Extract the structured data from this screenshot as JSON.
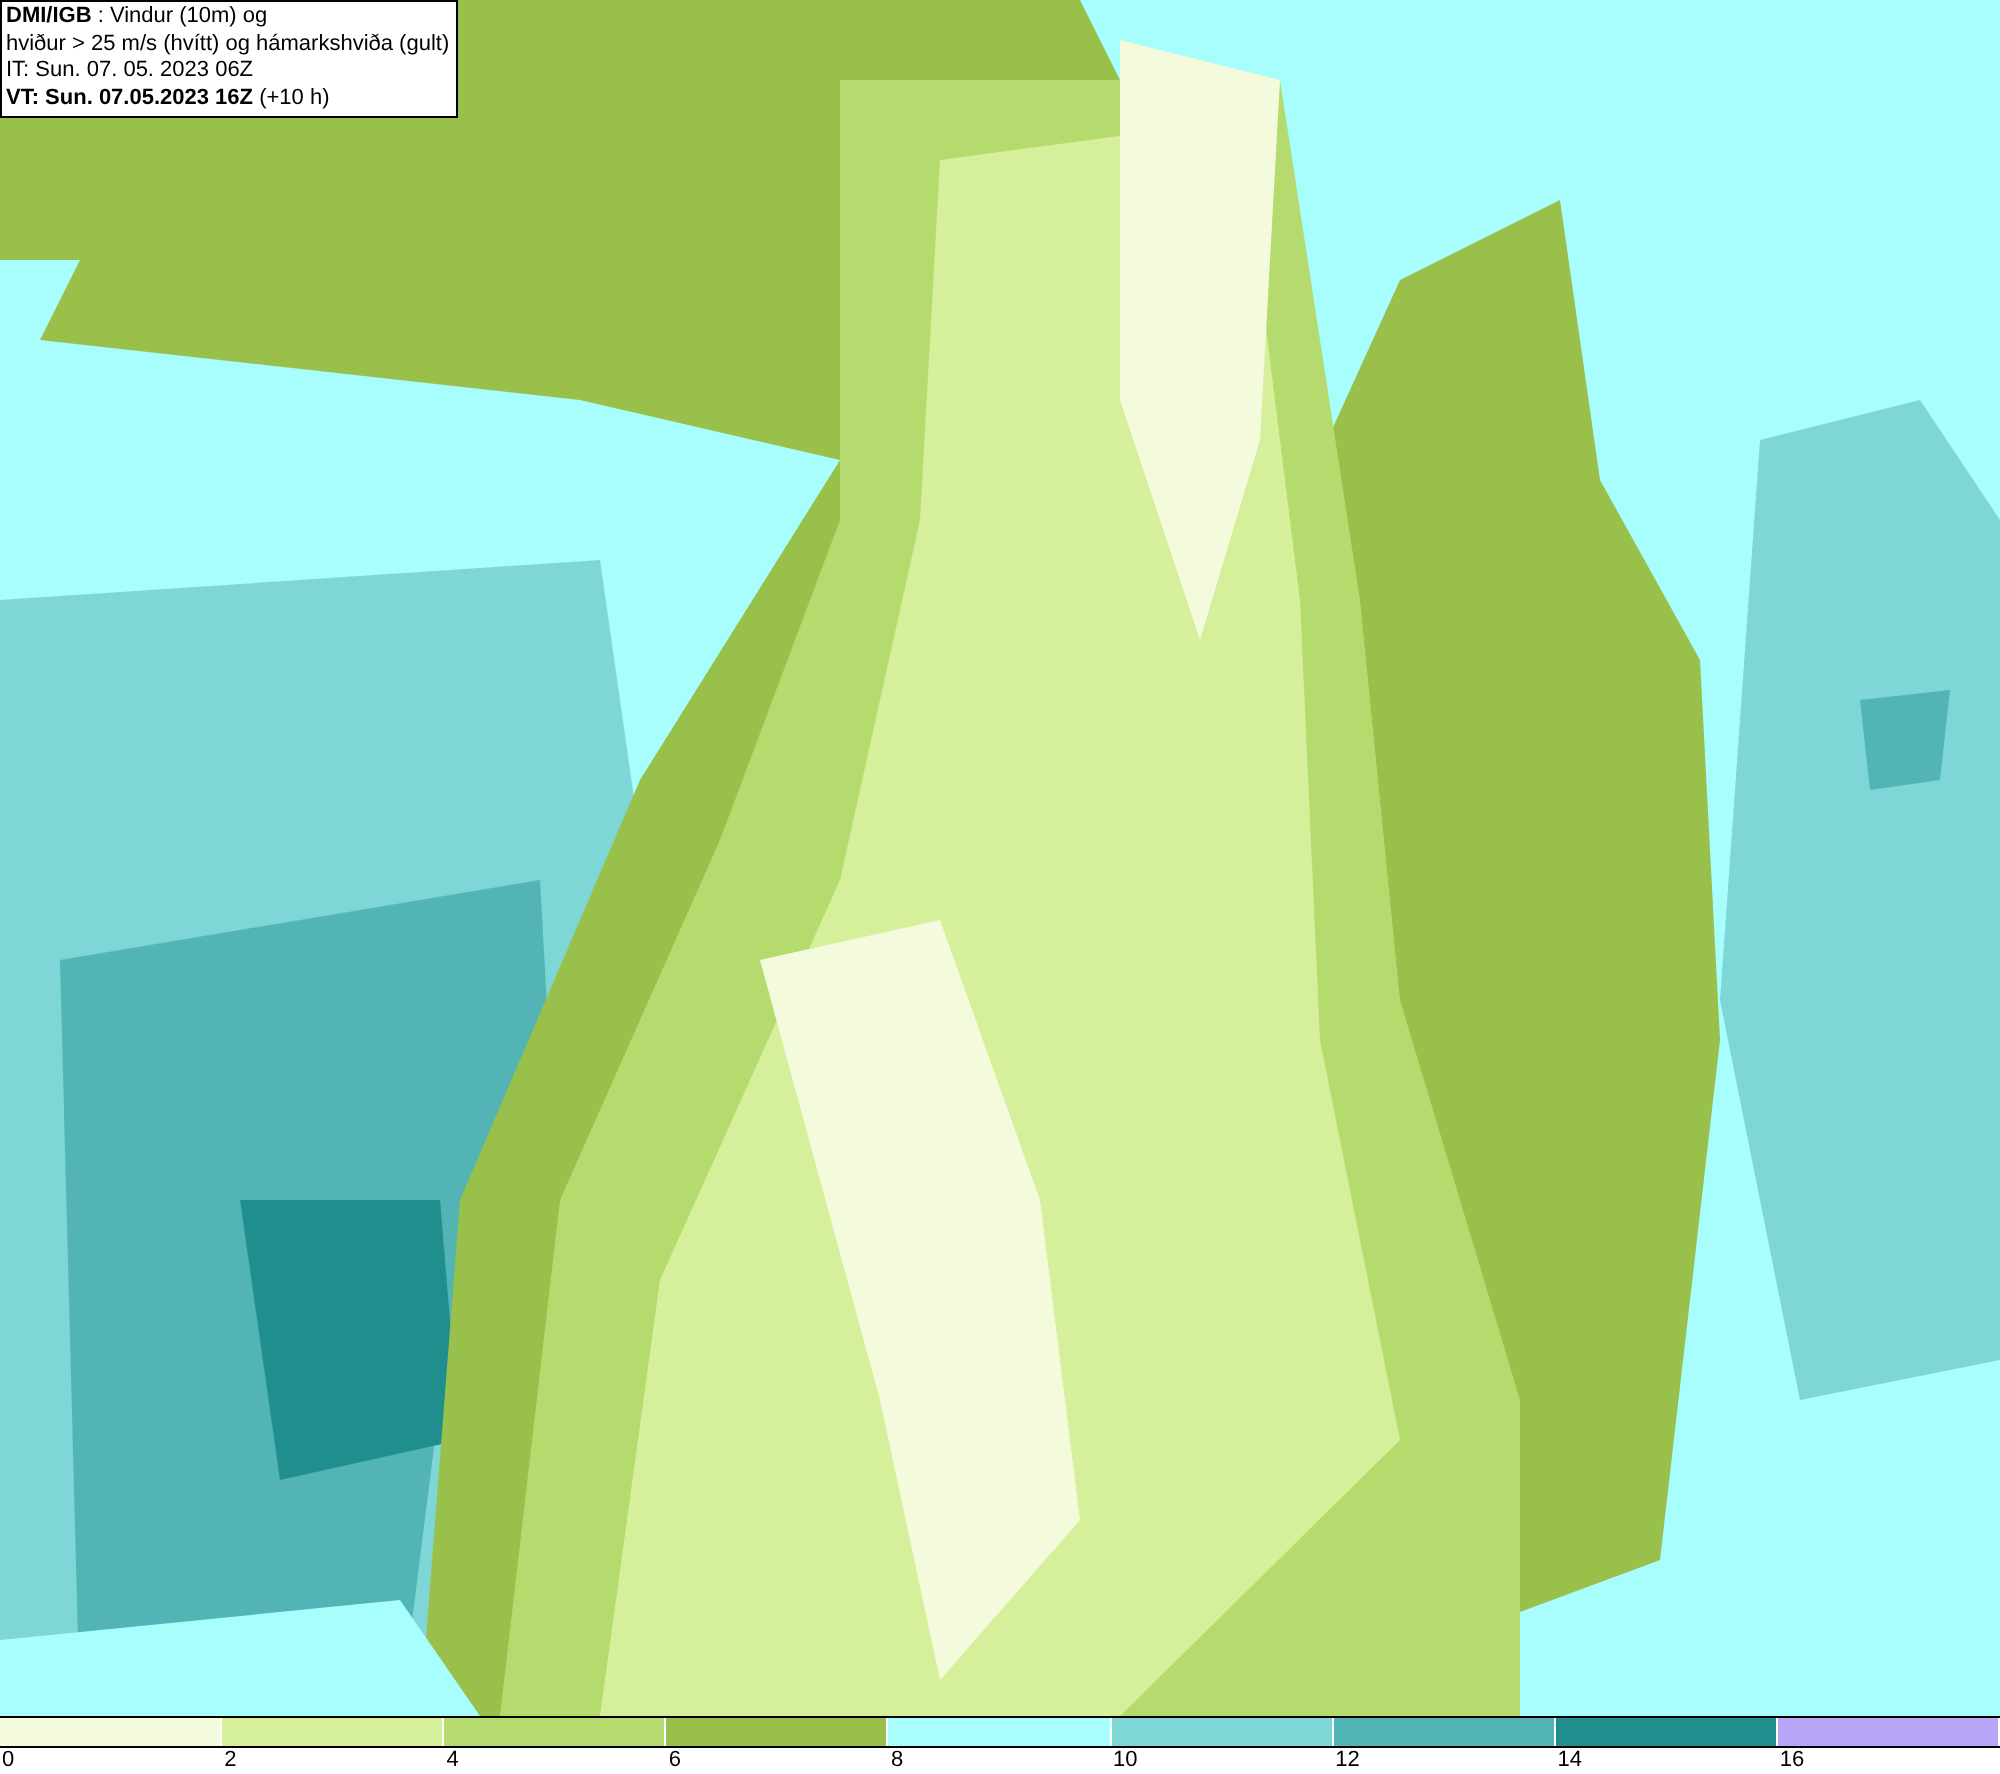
{
  "info_box": {
    "lines": [
      "**DMI/IGB** : Vindur (10m) og",
      "hviður > 25 m/s (hvítt) og hámarkshviða (gult)",
      "IT: Sun. 07. 05. 2023 06Z",
      "**VT: Sun. 07.05.2023 16Z** (+10 h)"
    ]
  },
  "legend": {
    "bins": [
      {
        "color": "#f4fbdc"
      },
      {
        "color": "#d5ef9a"
      },
      {
        "color": "#b5db6e"
      },
      {
        "color": "#98c04a"
      },
      {
        "color": "#a8fdfd"
      },
      {
        "color": "#7fd6d6"
      },
      {
        "color": "#52b4b4"
      },
      {
        "color": "#218e8e"
      },
      {
        "color": "#b9a5f5"
      }
    ],
    "ticks": [
      "0",
      "2",
      "4",
      "6",
      "8",
      "10",
      "12",
      "14",
      "16"
    ]
  }
}
